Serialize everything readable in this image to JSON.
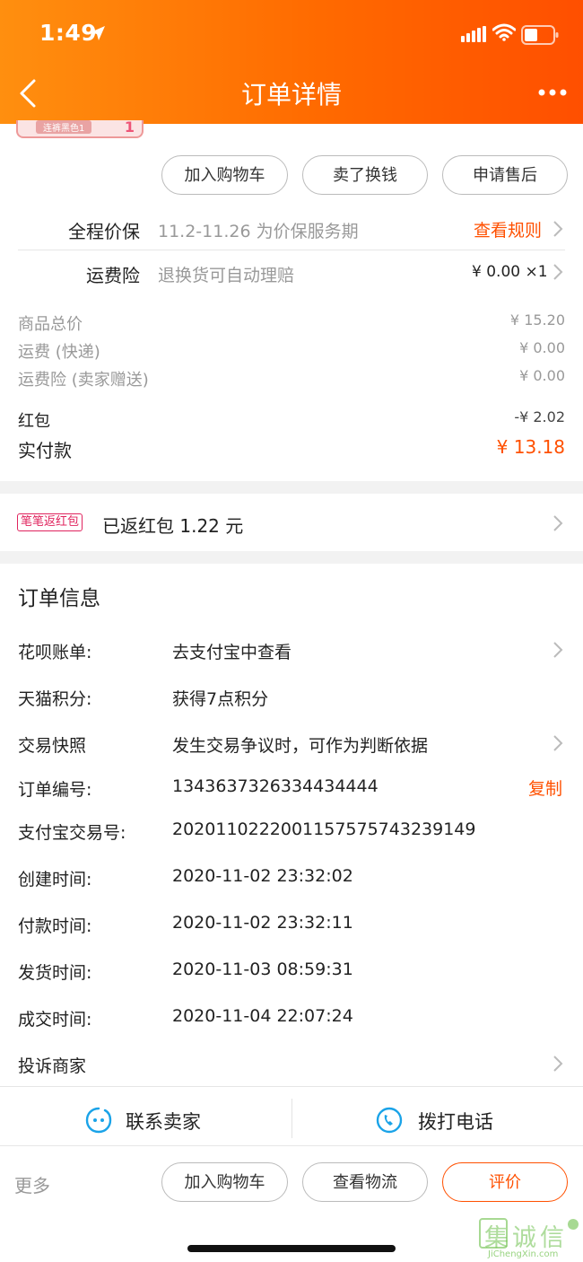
{
  "status_bar": {
    "time": "1:49"
  },
  "header": {
    "title": "订单详情"
  },
  "product_thumb": {
    "label": "连裤黑色1",
    "count": "1"
  },
  "top_actions": [
    "加入购物车",
    "卖了换钱",
    "申请售后"
  ],
  "price_protect": {
    "label": "全程价保",
    "value": "11.2-11.26 为价保服务期",
    "link": "查看规则"
  },
  "shipping_insurance": {
    "label": "运费险",
    "value": "退换货可自动理赔",
    "amount": "¥ 0.00 ×1"
  },
  "costs": {
    "goods_total_label": "商品总价",
    "goods_total": "¥ 15.20",
    "shipping_label": "运费 (快递)",
    "shipping": "¥ 0.00",
    "ins_label": "运费险 (卖家赠送)",
    "ins": "¥ 0.00",
    "redpacket_label": "红包",
    "redpacket": "-¥ 2.02",
    "paid_label": "实付款",
    "paid": "¥ 13.18"
  },
  "rebate": {
    "badge": "笔笔返红包",
    "text": "已返红包 1.22 元"
  },
  "order_info": {
    "title": "订单信息",
    "rows": [
      {
        "label": "花呗账单:",
        "value": "去支付宝中查看"
      },
      {
        "label": "天猫积分:",
        "value": "获得7点积分"
      },
      {
        "label": "交易快照",
        "value": "发生交易争议时，可作为判断依据"
      },
      {
        "label": "订单编号:",
        "value": "1343637326334434444",
        "action": "复制"
      },
      {
        "label": "支付宝交易号:",
        "value": "2020110222001157575743239149"
      },
      {
        "label": "创建时间:",
        "value": "2020-11-02 23:32:02"
      },
      {
        "label": "付款时间:",
        "value": "2020-11-02 23:32:11"
      },
      {
        "label": "发货时间:",
        "value": "2020-11-03 08:59:31"
      },
      {
        "label": "成交时间:",
        "value": "2020-11-04 22:07:24"
      }
    ],
    "complaint": "投诉商家"
  },
  "contact": {
    "seller": "联系卖家",
    "phone": "拨打电话"
  },
  "bottom_actions": {
    "more": "更多",
    "cart": "加入购物车",
    "logistics": "查看物流",
    "review": "评价"
  },
  "watermark": {
    "text": "集诚信",
    "url": "JiChengXin.com"
  },
  "colors": {
    "accent": "#ff5000",
    "header_start": "#ff8f0f",
    "header_end": "#ff4f00"
  }
}
